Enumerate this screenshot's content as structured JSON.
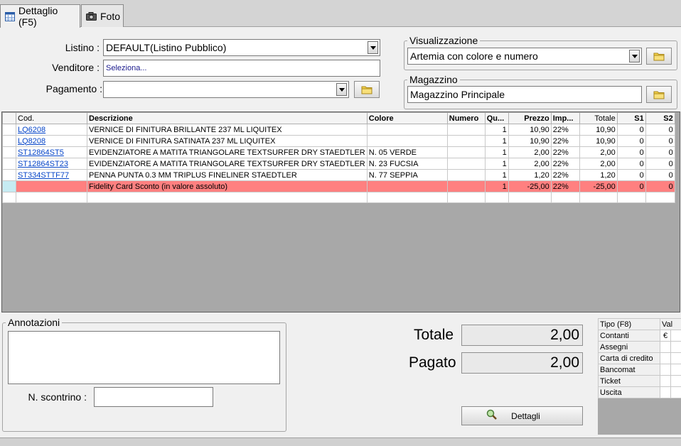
{
  "tabs": [
    {
      "label": "Dettaglio (F5)",
      "icon": "calendar-icon",
      "active": true
    },
    {
      "label": "Foto",
      "icon": "camera-icon",
      "active": false
    }
  ],
  "form": {
    "listino_label": "Listino :",
    "listino_value": "DEFAULT(Listino Pubblico)",
    "venditore_label": "Venditore :",
    "venditore_value": "Seleziona...",
    "pagamento_label": "Pagamento :",
    "pagamento_value": ""
  },
  "visualizzazione": {
    "title": "Visualizzazione",
    "value": "Artemia con colore e numero"
  },
  "magazzino": {
    "title": "Magazzino",
    "value": "Magazzino Principale"
  },
  "grid": {
    "headers": {
      "cod": "Cod.",
      "descrizione": "Descrizione",
      "colore": "Colore",
      "numero": "Numero",
      "qu": "Qu...",
      "prezzo": "Prezzo",
      "imp": "Imp...",
      "totale": "Totale",
      "s1": "S1",
      "s2": "S2"
    },
    "rows": [
      {
        "cod": "LQ6208",
        "descrizione": "VERNICE DI FINITURA BRILLANTE 237 ML LIQUITEX",
        "colore": "",
        "numero": "",
        "qu": "1",
        "prezzo": "10,90",
        "imp": "22%",
        "totale": "10,90",
        "s1": "0",
        "s2": "0"
      },
      {
        "cod": "LQ8208",
        "descrizione": "VERNICE DI FINITURA SATINATA 237 ML LIQUITEX",
        "colore": "",
        "numero": "",
        "qu": "1",
        "prezzo": "10,90",
        "imp": "22%",
        "totale": "10,90",
        "s1": "0",
        "s2": "0"
      },
      {
        "cod": "ST12864ST5",
        "descrizione": "EVIDENZIATORE A MATITA TRIANGOLARE TEXTSURFER DRY STAEDTLER",
        "colore": "N. 05 VERDE",
        "numero": "",
        "qu": "1",
        "prezzo": "2,00",
        "imp": "22%",
        "totale": "2,00",
        "s1": "0",
        "s2": "0"
      },
      {
        "cod": "ST12864ST23",
        "descrizione": "EVIDENZIATORE A MATITA TRIANGOLARE TEXTSURFER DRY STAEDTLER",
        "colore": "N. 23 FUCSIA",
        "numero": "",
        "qu": "1",
        "prezzo": "2,00",
        "imp": "22%",
        "totale": "2,00",
        "s1": "0",
        "s2": "0"
      },
      {
        "cod": "ST334STTF77",
        "descrizione": "PENNA PUNTA 0.3 MM TRIPLUS FINELINER STAEDTLER",
        "colore": "N. 77 SEPPIA",
        "numero": "",
        "qu": "1",
        "prezzo": "1,20",
        "imp": "22%",
        "totale": "1,20",
        "s1": "0",
        "s2": "0"
      },
      {
        "cod": "",
        "descrizione": "Fidelity Card Sconto (in valore assoluto)",
        "colore": "",
        "numero": "",
        "qu": "1",
        "prezzo": "-25,00",
        "imp": "22%",
        "totale": "-25,00",
        "s1": "0",
        "s2": "0"
      }
    ]
  },
  "annotazioni": {
    "title": "Annotazioni",
    "scontrino_label": "N. scontrino :",
    "scontrino_value": ""
  },
  "totals": {
    "totale_label": "Totale",
    "totale_value": "2,00",
    "pagato_label": "Pagato",
    "pagato_value": "2,00"
  },
  "dettagli_button": "Dettagli",
  "payments": {
    "header_tipo": "Tipo (F8)",
    "header_val": "Val",
    "rows": [
      {
        "tipo": "Contanti",
        "val": "€"
      },
      {
        "tipo": "Assegni",
        "val": ""
      },
      {
        "tipo": "Carta di credito",
        "val": ""
      },
      {
        "tipo": "Bancomat",
        "val": ""
      },
      {
        "tipo": "Ticket",
        "val": ""
      },
      {
        "tipo": "Uscita",
        "val": ""
      }
    ]
  },
  "colors": {
    "highlight_row": "#ff8080",
    "link": "#0645c8",
    "selected_cell": "#c6ecf3"
  }
}
